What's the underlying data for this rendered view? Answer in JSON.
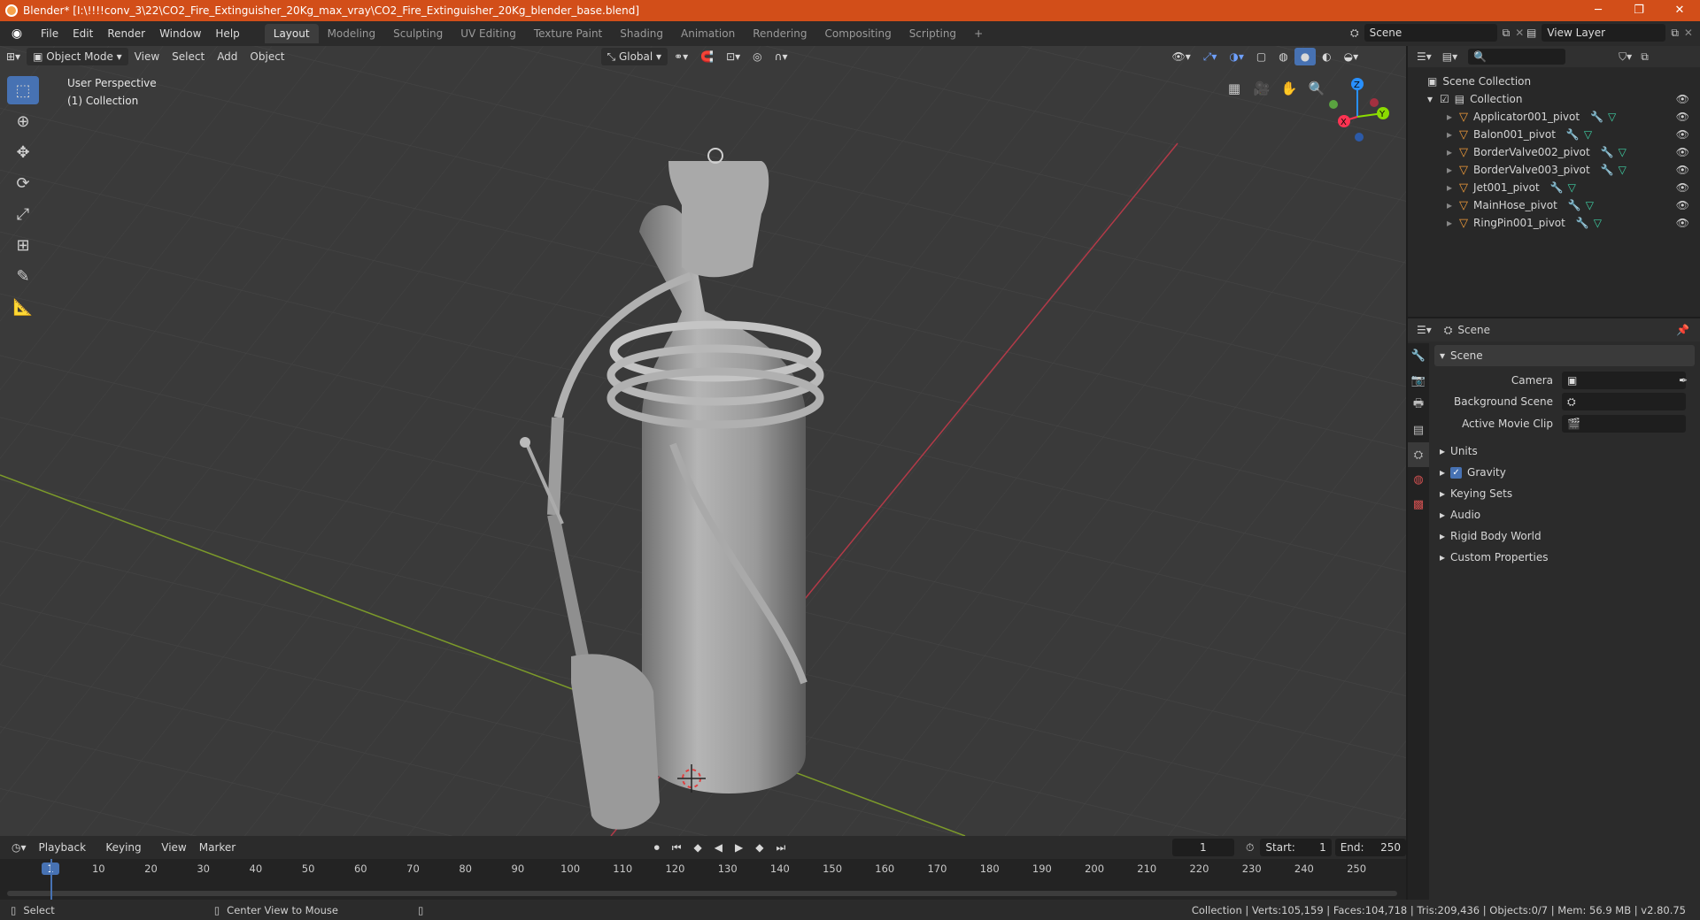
{
  "titlebar": {
    "title": "Blender* [I:\\!!!!conv_3\\22\\CO2_Fire_Extinguisher_20Kg_max_vray\\CO2_Fire_Extinguisher_20Kg_blender_base.blend]",
    "minimize": "─",
    "maximize": "❐",
    "close": "✕"
  },
  "menu": {
    "items": [
      "File",
      "Edit",
      "Render",
      "Window",
      "Help"
    ]
  },
  "workspaces": [
    "Layout",
    "Modeling",
    "Sculpting",
    "UV Editing",
    "Texture Paint",
    "Shading",
    "Animation",
    "Rendering",
    "Compositing",
    "Scripting",
    "+"
  ],
  "scene_selector": {
    "value": "Scene"
  },
  "view_layer_selector": {
    "value": "View Layer"
  },
  "viewport_header": {
    "mode": "Object Mode",
    "view": "View",
    "select": "Select",
    "add": "Add",
    "object": "Object",
    "orientation": "Global"
  },
  "viewport_info": {
    "perspective": "User Perspective",
    "collection": "(1) Collection"
  },
  "gizmo": {
    "x": "X",
    "y": "Y",
    "z": "Z"
  },
  "outliner": {
    "root": "Scene Collection",
    "collection": "Collection",
    "items": [
      {
        "name": "Applicator001_pivot"
      },
      {
        "name": "Balon001_pivot"
      },
      {
        "name": "BorderValve002_pivot"
      },
      {
        "name": "BorderValve003_pivot"
      },
      {
        "name": "Jet001_pivot"
      },
      {
        "name": "MainHose_pivot"
      },
      {
        "name": "RingPin001_pivot"
      }
    ]
  },
  "properties": {
    "context": "Scene",
    "panel_title": "Scene",
    "camera_label": "Camera",
    "background_scene_label": "Background Scene",
    "active_movie_clip_label": "Active Movie Clip",
    "sections": [
      "Units",
      "Gravity",
      "Keying Sets",
      "Audio",
      "Rigid Body World",
      "Custom Properties"
    ],
    "gravity_checked": true
  },
  "timeline": {
    "playback": "Playback",
    "keying": "Keying",
    "view": "View",
    "marker": "Marker",
    "current_frame": "1",
    "start_label": "Start:",
    "start": "1",
    "end_label": "End:",
    "end": "250",
    "ticks": [
      "1",
      "10",
      "20",
      "30",
      "40",
      "50",
      "60",
      "70",
      "80",
      "90",
      "100",
      "110",
      "120",
      "130",
      "140",
      "150",
      "160",
      "170",
      "180",
      "190",
      "200",
      "210",
      "220",
      "230",
      "240",
      "250"
    ]
  },
  "statusbar": {
    "select": "Select",
    "center_view": "Center View to Mouse",
    "stats": "Collection | Verts:105,159 | Faces:104,718 | Tris:209,436 | Objects:0/7 | Mem: 56.9 MB | v2.80.75"
  },
  "colors": {
    "accent": "#4772b3",
    "titlebar": "#d24e19",
    "x_axis": "#ff3352",
    "y_axis": "#8bdc00",
    "z_axis": "#2890ff"
  }
}
